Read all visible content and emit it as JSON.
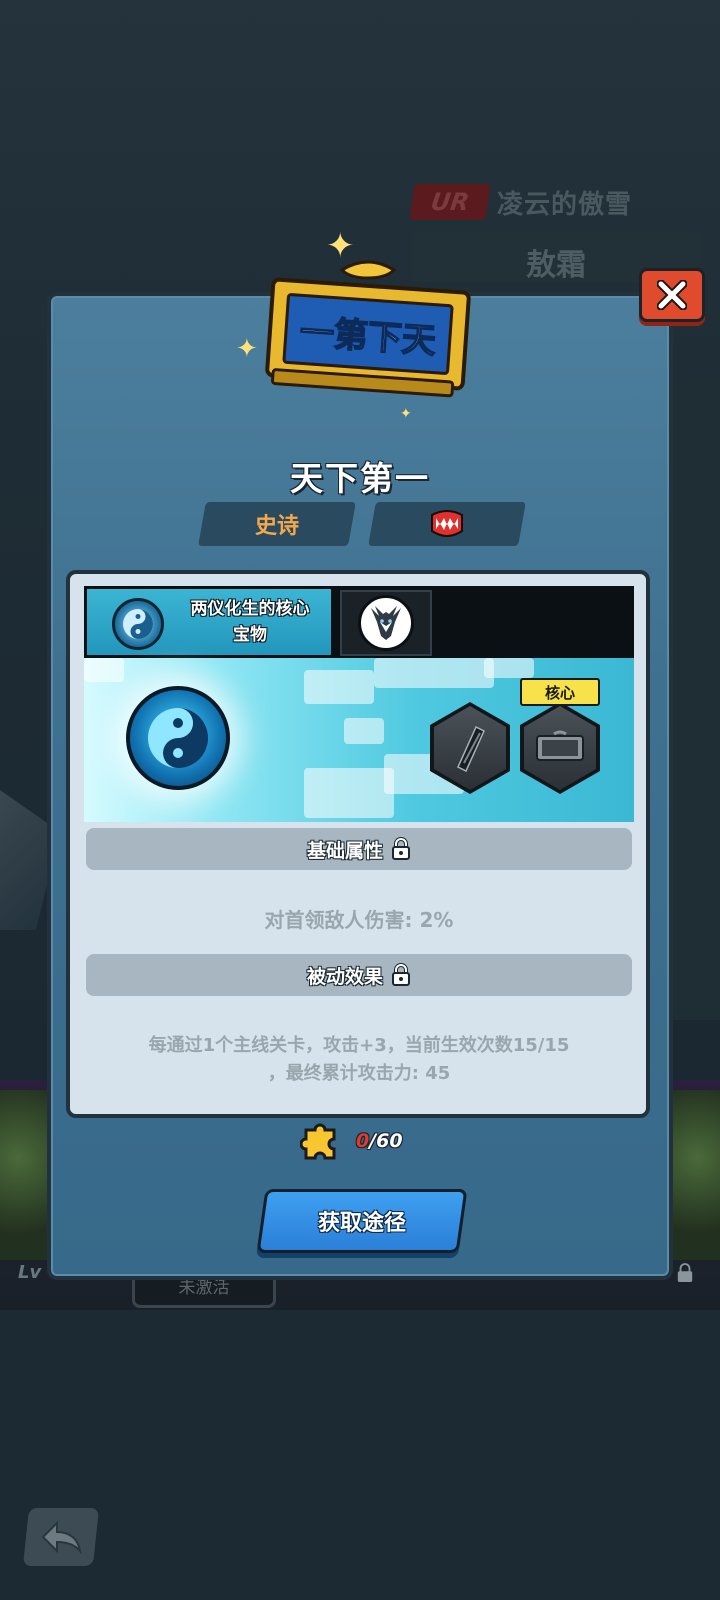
{
  "background": {
    "rarity_tag": "UR",
    "hero_title": "凌云的傲雪",
    "hero_name": "敖霜",
    "level_prefix": "Lv",
    "inactive_label": "未激活"
  },
  "dialog": {
    "plaque_text": "一第下天",
    "item_title": "天下第一",
    "rarity": "史诗",
    "tabs": [
      {
        "label": "两仪化生的核心宝物",
        "line1": "两仪化生的核心",
        "line2": "宝物",
        "icon": "yin-yang-icon",
        "active": true
      },
      {
        "label": "",
        "icon": "white-dragon-icon",
        "active": false
      }
    ],
    "core_badge": "核心",
    "basic_attr": {
      "title": "基础属性",
      "locked": true,
      "text": "对首领敌人伤害: 2%"
    },
    "passive": {
      "title": "被动效果",
      "locked": true,
      "line1": "每通过1个主线关卡，攻击+3，当前生效次数15/15",
      "line2": "，最终累计攻击力: 45"
    },
    "fragments": {
      "current": "0",
      "total": "/60"
    },
    "obtain_button": "获取途径"
  },
  "colors": {
    "accent_blue": "#2b7fd8",
    "close_red": "#e04a2d",
    "rarity_orange": "#f5a94a",
    "badge_yellow": "#f7e24a"
  }
}
